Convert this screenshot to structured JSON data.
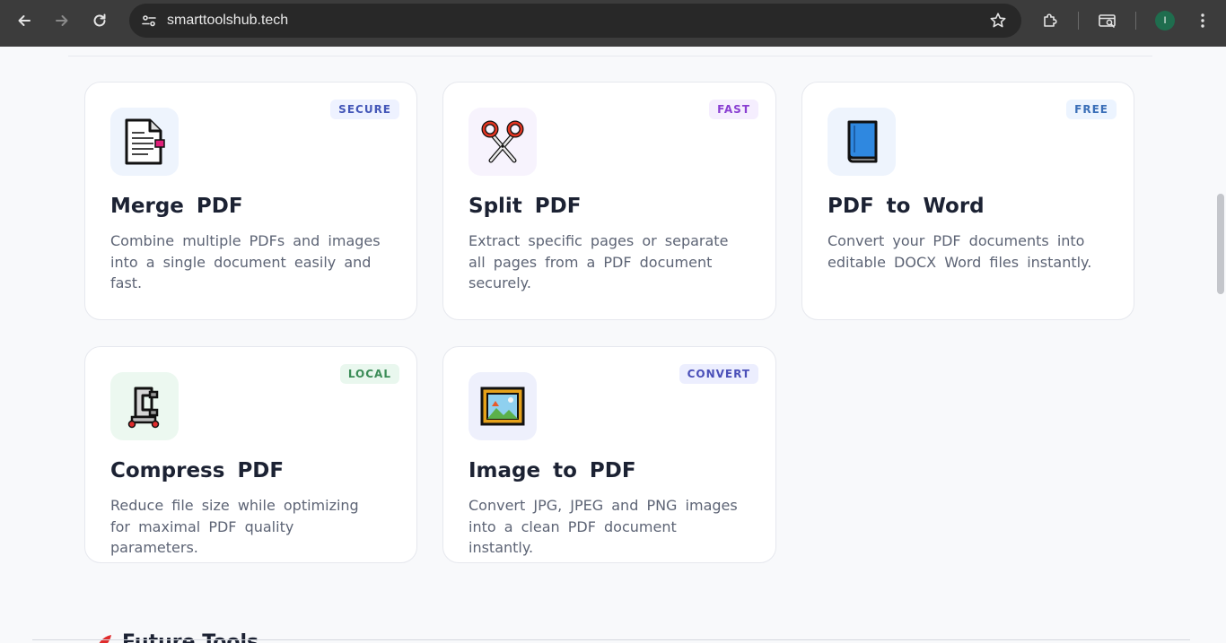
{
  "browser": {
    "url": "smarttoolshub.tech",
    "profile_initial": "I"
  },
  "tools": [
    {
      "title": "Merge PDF",
      "badge": "SECURE",
      "description": "Combine multiple PDFs and images into a single document easily and fast.",
      "icon": "document-icon"
    },
    {
      "title": "Split PDF",
      "badge": "FAST",
      "description": "Extract specific pages or separate all pages from a PDF document securely.",
      "icon": "scissors-icon"
    },
    {
      "title": "PDF to Word",
      "badge": "FREE",
      "description": "Convert your PDF documents into editable DOCX Word files instantly.",
      "icon": "blue-book-icon"
    },
    {
      "title": "Compress PDF",
      "badge": "LOCAL",
      "description": "Reduce file size while optimizing for maximal PDF quality parameters.",
      "icon": "clamp-icon"
    },
    {
      "title": "Image to PDF",
      "badge": "CONVERT",
      "description": "Convert JPG, JPEG and PNG images into a clean PDF document instantly.",
      "icon": "framed-picture-icon"
    }
  ],
  "next_section": {
    "heading": "Future Tools"
  },
  "colors": {
    "chrome_bg": "#3c3c3c",
    "omnibox_bg": "#282828",
    "page_bg": "#f8f9fb",
    "card_border": "#e6e8ee",
    "title_text": "#1c2233",
    "body_text": "#5d6475"
  }
}
